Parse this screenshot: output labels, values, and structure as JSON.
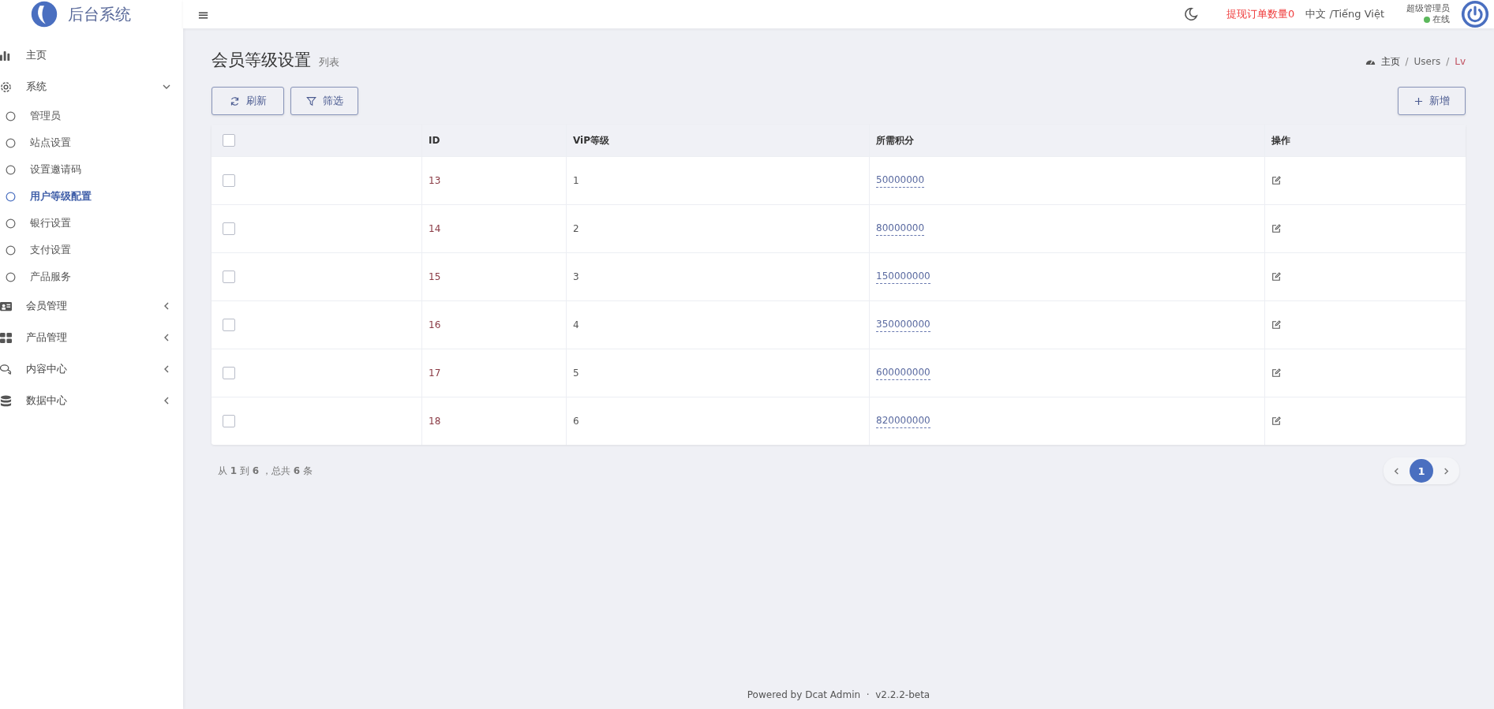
{
  "brand": {
    "title": "后台系统"
  },
  "sidebar": {
    "items": [
      {
        "label": "主页"
      },
      {
        "label": "系统",
        "expanded": true,
        "children": [
          {
            "label": "管理员",
            "selected": false
          },
          {
            "label": "站点设置",
            "selected": false
          },
          {
            "label": "设置邀请码",
            "selected": false
          },
          {
            "label": "用户等级配置",
            "selected": true
          },
          {
            "label": "银行设置",
            "selected": false
          },
          {
            "label": "支付设置",
            "selected": false
          },
          {
            "label": "产品服务",
            "selected": false
          }
        ]
      },
      {
        "label": "会员管理",
        "expanded": false
      },
      {
        "label": "产品管理",
        "expanded": false
      },
      {
        "label": "内容中心",
        "expanded": false
      },
      {
        "label": "数据中心",
        "expanded": false
      }
    ]
  },
  "header": {
    "menu_glyph": "≡",
    "withdraw_notice": "提现订单数量0",
    "language": "中文 /Tiếng Việt",
    "user": {
      "name": "超级管理员",
      "status": "在线",
      "online": true
    }
  },
  "page": {
    "title": "会员等级设置",
    "subtitle": "列表",
    "breadcrumb": [
      "主页",
      "Users",
      "Lv"
    ],
    "breadcrumb_separator": "/"
  },
  "toolbar": {
    "buttons": [
      "刷新",
      "筛选"
    ],
    "create_button": "新增"
  },
  "table": {
    "columns": [
      "ID",
      "ViP等级",
      "所需积分",
      "操作"
    ],
    "all_checked": false,
    "rows": [
      {
        "checked": false,
        "id": "13",
        "level": "1",
        "points": "50000000"
      },
      {
        "checked": false,
        "id": "14",
        "level": "2",
        "points": "80000000"
      },
      {
        "checked": false,
        "id": "15",
        "level": "3",
        "points": "150000000"
      },
      {
        "checked": false,
        "id": "16",
        "level": "4",
        "points": "350000000"
      },
      {
        "checked": false,
        "id": "17",
        "level": "5",
        "points": "600000000"
      },
      {
        "checked": false,
        "id": "18",
        "level": "6",
        "points": "820000000"
      }
    ]
  },
  "pagination": {
    "summary": "从 **1** 到 **6** ，总共 **6** 条",
    "pages": [
      {
        "label": "1",
        "selected": true
      }
    ]
  },
  "footer": "Powered by Dcat Admin  ·  v2.2.2-beta"
}
